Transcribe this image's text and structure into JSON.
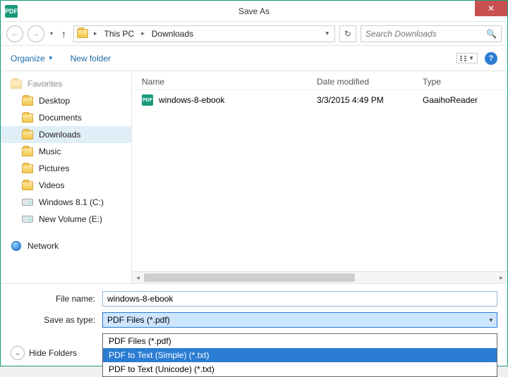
{
  "title": "Save As",
  "breadcrumbs": [
    "This PC",
    "Downloads"
  ],
  "search_placeholder": "Search Downloads",
  "toolbar": {
    "organize": "Organize",
    "new_folder": "New folder"
  },
  "sidebar": {
    "top_blur": "Favorites",
    "items": [
      {
        "label": "Desktop",
        "icon": "folder"
      },
      {
        "label": "Documents",
        "icon": "folder"
      },
      {
        "label": "Downloads",
        "icon": "folder",
        "selected": true
      },
      {
        "label": "Music",
        "icon": "folder"
      },
      {
        "label": "Pictures",
        "icon": "folder"
      },
      {
        "label": "Videos",
        "icon": "folder"
      },
      {
        "label": "Windows 8.1 (C:)",
        "icon": "drive"
      },
      {
        "label": "New Volume (E:)",
        "icon": "drive"
      }
    ],
    "network": "Network"
  },
  "columns": {
    "name": "Name",
    "date": "Date modified",
    "type": "Type"
  },
  "files": [
    {
      "name": "windows-8-ebook",
      "date": "3/3/2015 4:49 PM",
      "type": "GaaihoReader"
    }
  ],
  "form": {
    "filename_label": "File name:",
    "filename_value": "windows-8-ebook",
    "type_label": "Save as type:",
    "type_selected": "PDF Files (*.pdf)",
    "type_options": [
      "PDF Files (*.pdf)",
      "PDF to Text (Simple) (*.txt)",
      "PDF to Text (Unicode) (*.txt)"
    ],
    "type_highlight_index": 1
  },
  "footer": {
    "hide_folders": "Hide Folders"
  }
}
